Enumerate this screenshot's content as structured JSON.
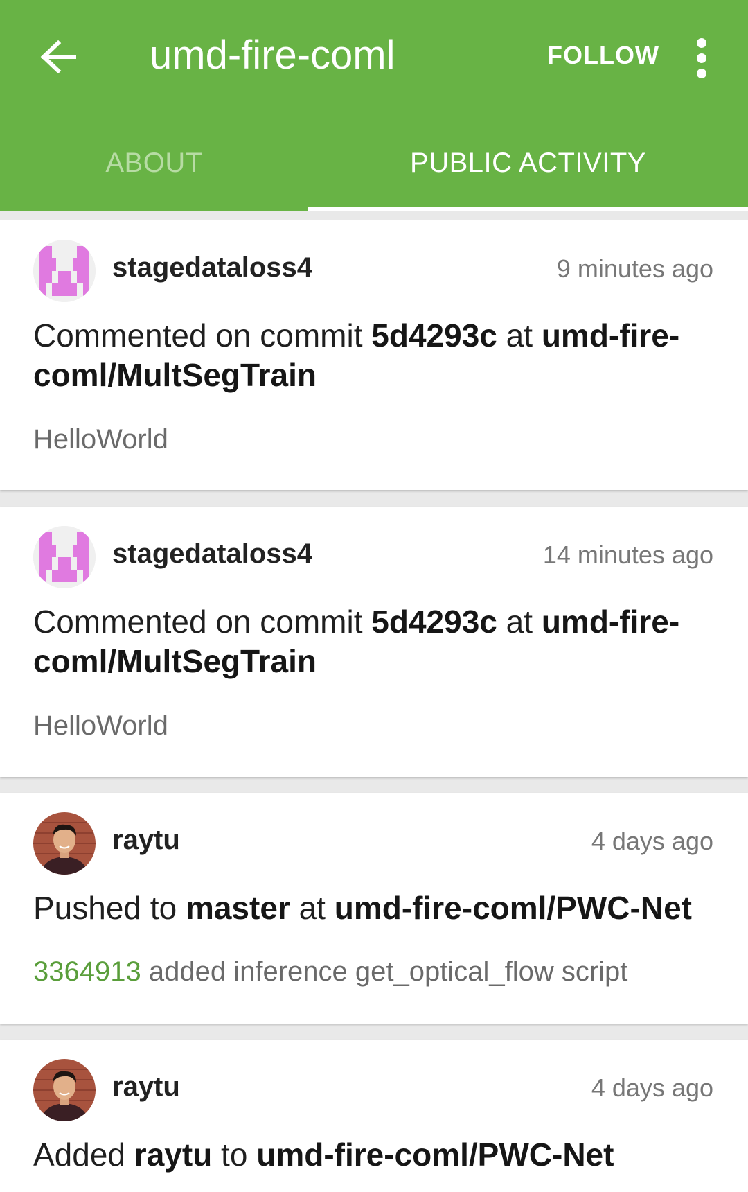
{
  "header": {
    "title": "umd-fire-coml",
    "follow_label": "FOLLOW",
    "accent_color": "#68b345"
  },
  "tabs": [
    {
      "label": "ABOUT",
      "selected": false
    },
    {
      "label": "PUBLIC ACTIVITY",
      "selected": true
    }
  ],
  "events": [
    {
      "user": "stagedataloss4",
      "time": "9 minutes ago",
      "avatar": "identicon-pink",
      "action_prefix": "Commented on commit ",
      "action_ref": "5d4293c",
      "action_mid": " at ",
      "action_repo": "umd-fire-coml/MultSegTrain",
      "detail": "HelloWorld"
    },
    {
      "user": "stagedataloss4",
      "time": "14 minutes ago",
      "avatar": "identicon-pink",
      "action_prefix": "Commented on commit ",
      "action_ref": "5d4293c",
      "action_mid": " at ",
      "action_repo": "umd-fire-coml/MultSegTrain",
      "detail": "HelloWorld"
    },
    {
      "user": "raytu",
      "time": "4 days ago",
      "avatar": "profile-photo",
      "action_prefix": "Pushed to ",
      "action_ref": "master",
      "action_mid": " at ",
      "action_repo": "umd-fire-coml/PWC-Net",
      "commit_sha": "3364913",
      "commit_message": " added inference get_optical_flow script"
    },
    {
      "user": "raytu",
      "time": "4 days ago",
      "avatar": "profile-photo",
      "action_prefix": "Added ",
      "action_ref": "raytu",
      "action_mid": " to ",
      "action_repo": "umd-fire-coml/PWC-Net"
    }
  ]
}
